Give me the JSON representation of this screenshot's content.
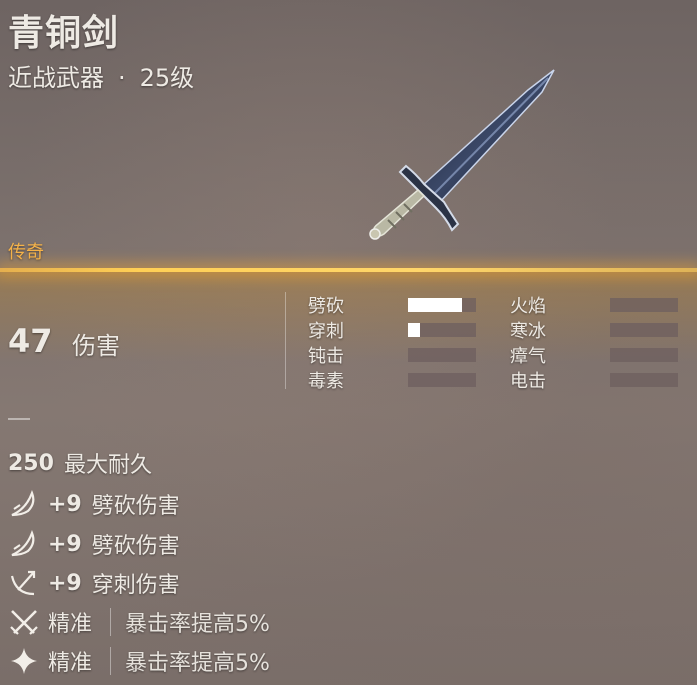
{
  "item": {
    "name": "青铜剑",
    "type": "近战武器",
    "separator": "·",
    "level": "25级",
    "rarity": "传奇",
    "rarity_color": "#f4b24a",
    "damage": {
      "value": "47",
      "label": "伤害"
    },
    "damage_types": [
      {
        "label": "劈砍",
        "fraction": 0.8
      },
      {
        "label": "穿刺",
        "fraction": 0.18
      },
      {
        "label": "钝击",
        "fraction": 0
      },
      {
        "label": "毒素",
        "fraction": 0
      },
      {
        "label": "火焰",
        "fraction": 0
      },
      {
        "label": "寒冰",
        "fraction": 0
      },
      {
        "label": "瘴气",
        "fraction": 0
      },
      {
        "label": "电击",
        "fraction": 0
      }
    ],
    "durability": {
      "value": "250",
      "label": "最大耐久"
    },
    "bonuses": [
      {
        "icon": "slash-icon",
        "value": "+9",
        "label": "劈砍伤害"
      },
      {
        "icon": "slash-icon",
        "value": "+9",
        "label": "劈砍伤害"
      },
      {
        "icon": "pierce-icon",
        "value": "+9",
        "label": "穿刺伤害"
      }
    ],
    "perks": [
      {
        "icon": "crossed-swords-icon",
        "name": "精准",
        "desc": "暴击率提高5%"
      },
      {
        "icon": "sparkle-icon",
        "name": "精准",
        "desc": "暴击率提高5%"
      }
    ]
  }
}
